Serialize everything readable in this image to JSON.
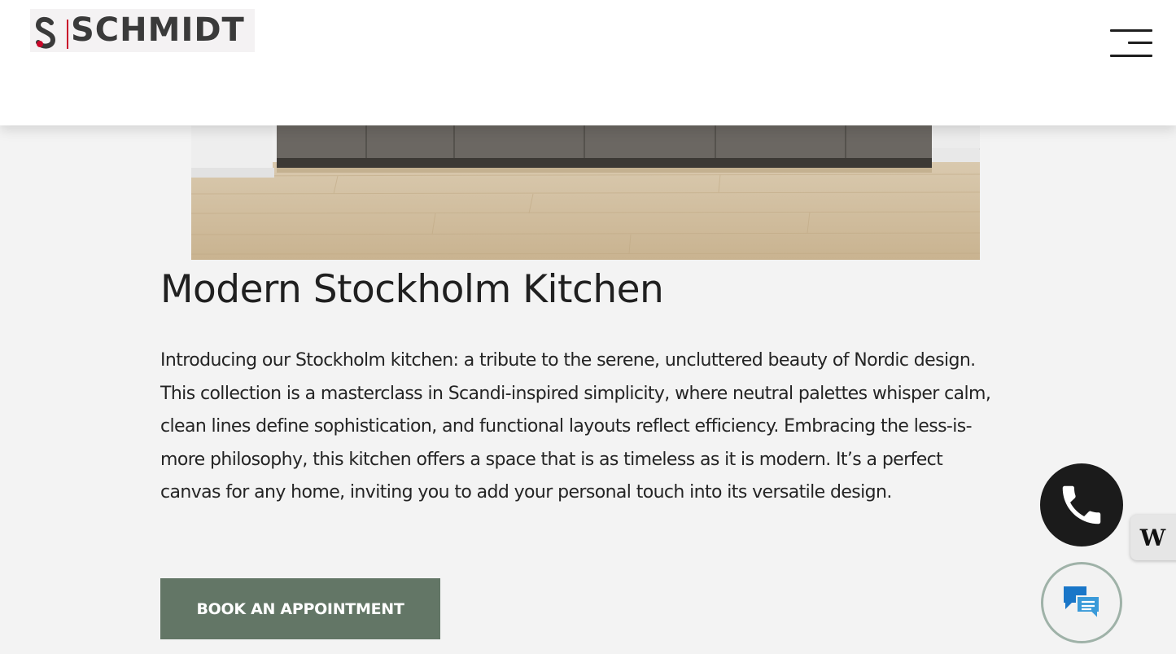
{
  "header": {
    "logo_text": "SCHMIDT",
    "logo_mark": "S",
    "menu_icon": "hamburger-menu-icon"
  },
  "main": {
    "title": "Modern Stockholm Kitchen",
    "description": "Introducing our Stockholm kitchen: a tribute to the serene, uncluttered beauty of Nordic design. This collection is a masterclass in Scandi-inspired simplicity, where neutral palettes whisper calm, clean lines define sophistication, and functional layouts reflect efficiency. Embracing the less-is-more philosophy, this kitchen offers a space that is as timeless as it is modern. It’s a perfect canvas for any home, inviting you to add your personal touch into its versatile design.",
    "book_button_label": "BOOK AN APPOINTMENT"
  },
  "widgets": {
    "call_icon": "phone-icon",
    "chat_icon": "chat-bubbles-icon",
    "badge_label": "W"
  },
  "colors": {
    "brand_red": "#c9082a",
    "button_green": "#637666",
    "page_bg": "#f3f3f3"
  }
}
